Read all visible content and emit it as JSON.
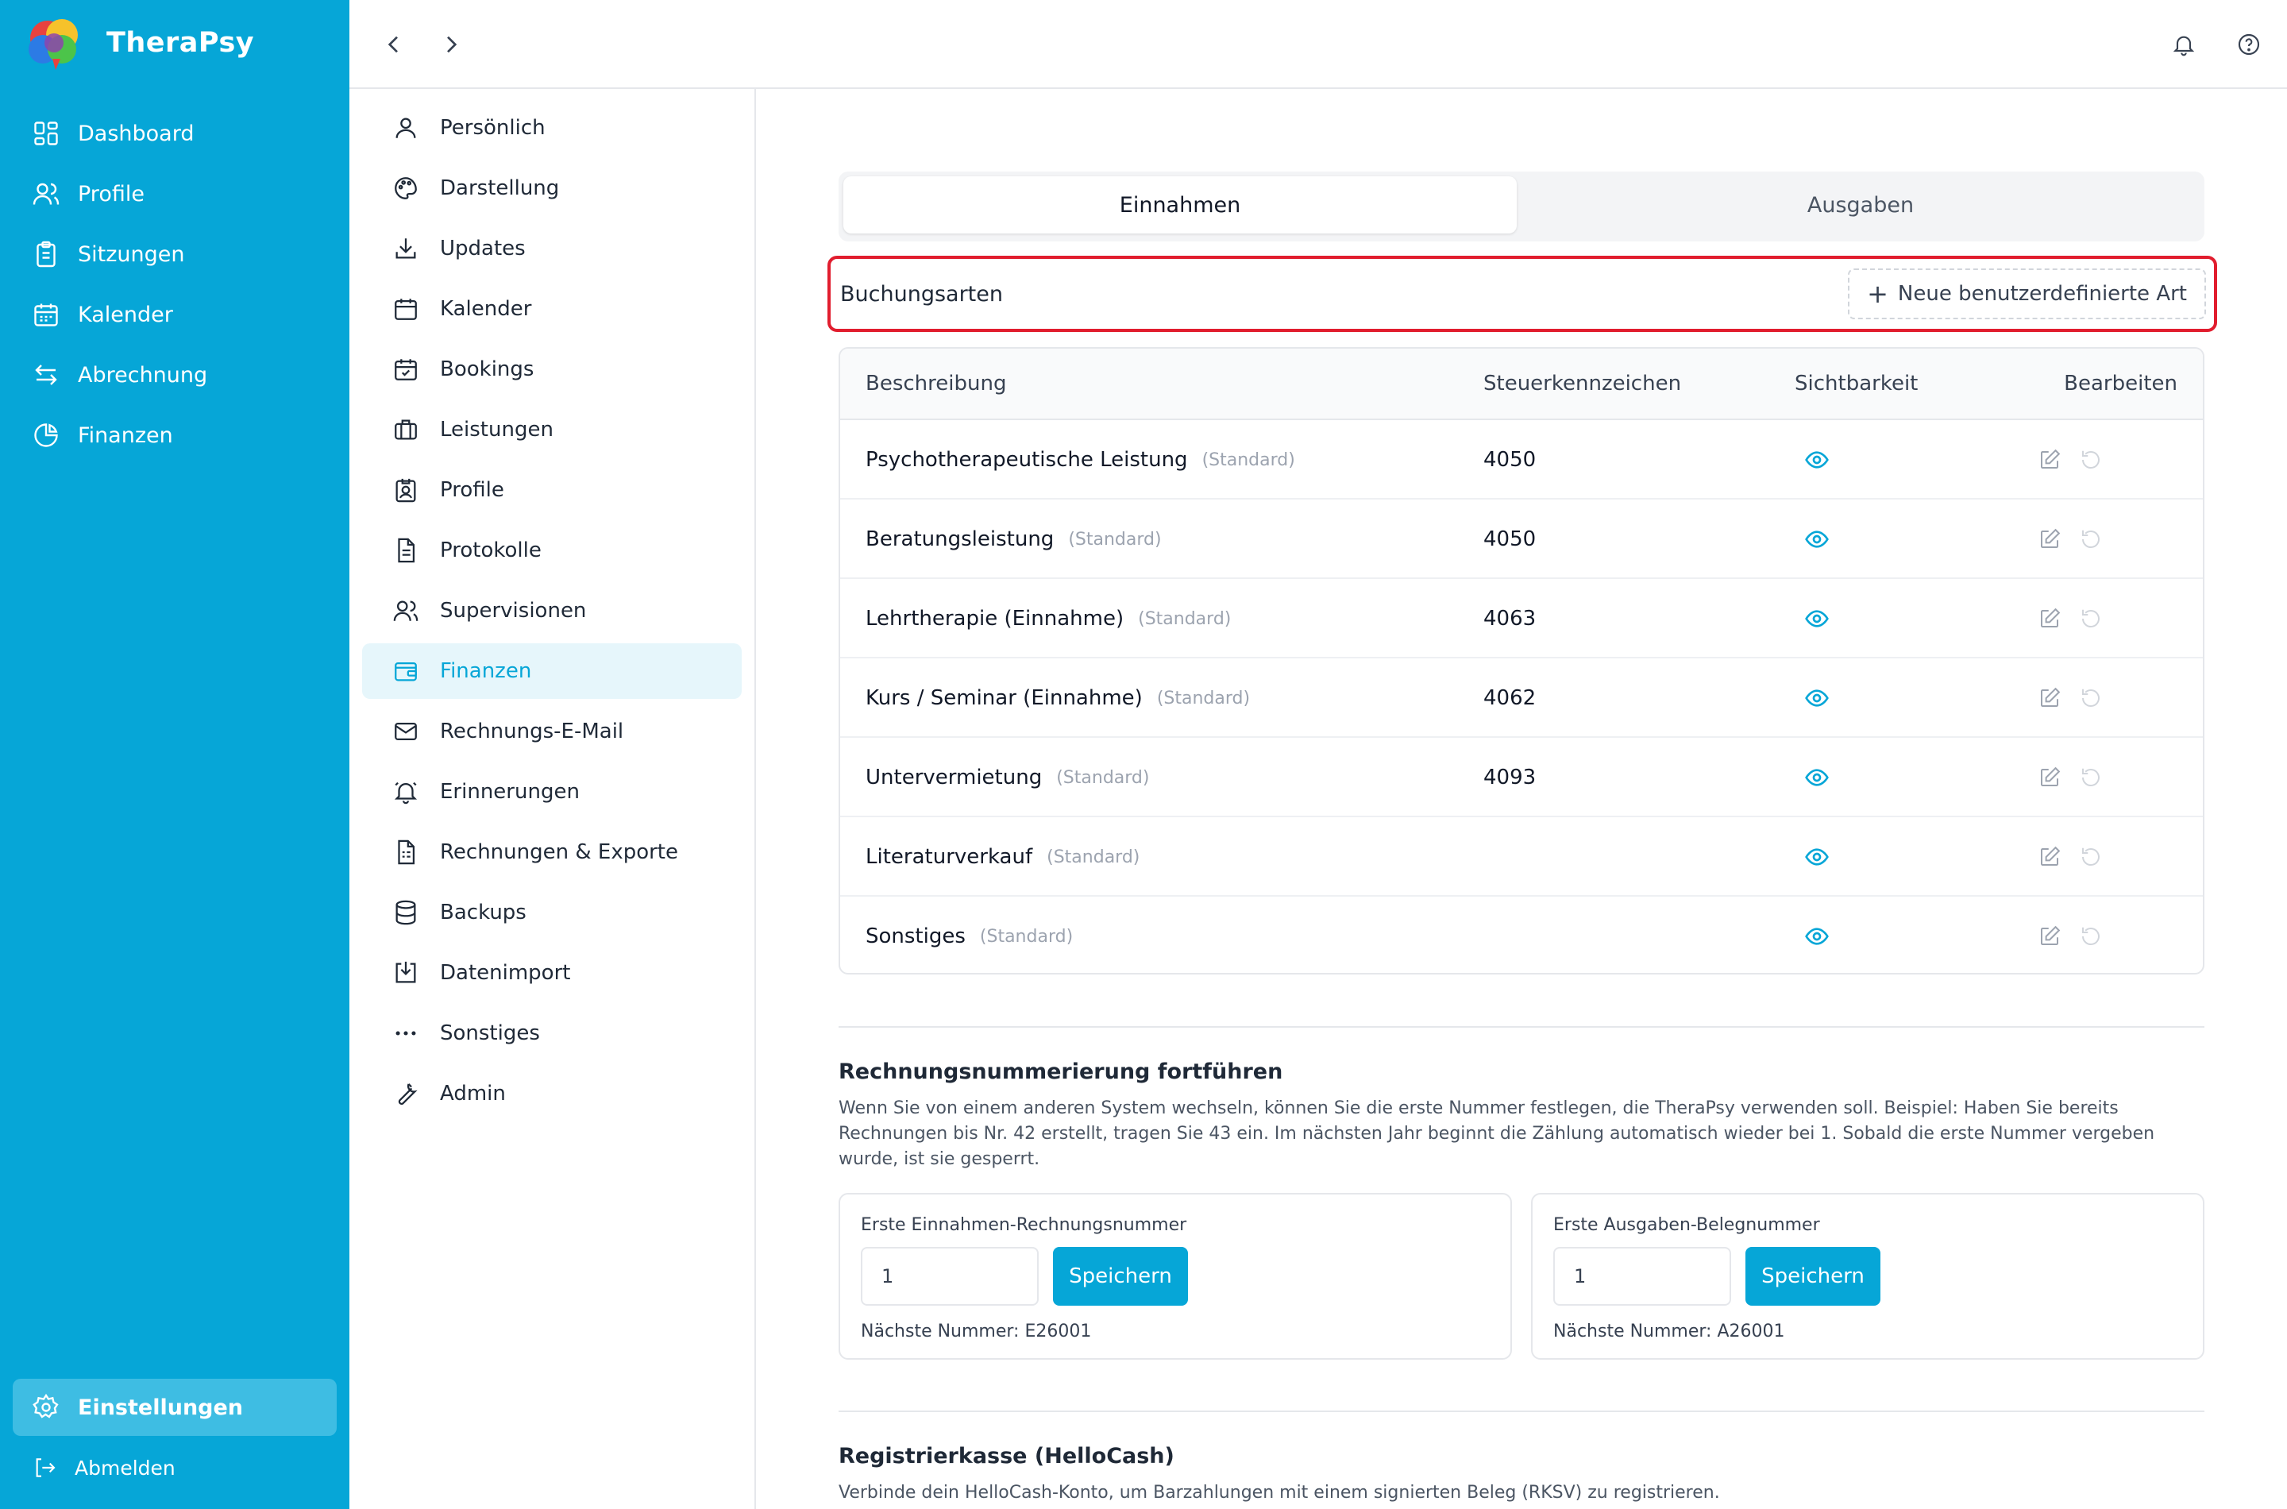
{
  "app": {
    "name": "TheraPsy"
  },
  "colors": {
    "brand": "#06a6d7",
    "highlight": "#e11d2e",
    "sidebar_active": "#3ebde3"
  },
  "sidebar": {
    "items": [
      {
        "label": "Dashboard",
        "icon": "dashboard-icon"
      },
      {
        "label": "Profile",
        "icon": "users-icon"
      },
      {
        "label": "Sitzungen",
        "icon": "clipboard-icon"
      },
      {
        "label": "Kalender",
        "icon": "calendar-icon"
      },
      {
        "label": "Abrechnung",
        "icon": "arrows-icon"
      },
      {
        "label": "Finanzen",
        "icon": "pie-chart-icon"
      }
    ],
    "settings_label": "Einstellungen",
    "logout_label": "Abmelden"
  },
  "submenu": {
    "items": [
      {
        "label": "Persönlich",
        "icon": "user-icon"
      },
      {
        "label": "Darstellung",
        "icon": "palette-icon"
      },
      {
        "label": "Updates",
        "icon": "download-icon"
      },
      {
        "label": "Kalender",
        "icon": "calendar-icon"
      },
      {
        "label": "Bookings",
        "icon": "calendar-check-icon"
      },
      {
        "label": "Leistungen",
        "icon": "briefcase-icon"
      },
      {
        "label": "Profile",
        "icon": "id-badge-icon"
      },
      {
        "label": "Protokolle",
        "icon": "document-icon"
      },
      {
        "label": "Supervisionen",
        "icon": "users-icon"
      },
      {
        "label": "Finanzen",
        "icon": "wallet-icon",
        "active": true
      },
      {
        "label": "Rechnungs-E-Mail",
        "icon": "mail-icon"
      },
      {
        "label": "Erinnerungen",
        "icon": "bell-icon"
      },
      {
        "label": "Rechnungen & Exporte",
        "icon": "invoice-icon"
      },
      {
        "label": "Backups",
        "icon": "database-icon"
      },
      {
        "label": "Datenimport",
        "icon": "import-icon"
      },
      {
        "label": "Sonstiges",
        "icon": "dots-icon"
      },
      {
        "label": "Admin",
        "icon": "wrench-icon"
      }
    ]
  },
  "tabs": {
    "income": "Einnahmen",
    "expenses": "Ausgaben"
  },
  "booking_types": {
    "title": "Buchungsarten",
    "new_button": "Neue benutzerdefinierte Art",
    "columns": {
      "description": "Beschreibung",
      "tax": "Steuerkennzeichen",
      "visibility": "Sichtbarkeit",
      "edit": "Bearbeiten"
    },
    "rows": [
      {
        "name": "Psychotherapeutische Leistung",
        "tag": "(Standard)",
        "tax": "4050"
      },
      {
        "name": "Beratungsleistung",
        "tag": "(Standard)",
        "tax": "4050"
      },
      {
        "name": "Lehrtherapie (Einnahme)",
        "tag": "(Standard)",
        "tax": "4063"
      },
      {
        "name": "Kurs / Seminar (Einnahme)",
        "tag": "(Standard)",
        "tax": "4062"
      },
      {
        "name": "Untervermietung",
        "tag": "(Standard)",
        "tax": "4093"
      },
      {
        "name": "Literaturverkauf",
        "tag": "(Standard)",
        "tax": ""
      },
      {
        "name": "Sonstiges",
        "tag": "(Standard)",
        "tax": ""
      }
    ]
  },
  "numbering": {
    "title": "Rechnungsnummerierung fortführen",
    "description": "Wenn Sie von einem anderen System wechseln, können Sie die erste Nummer festlegen, die TheraPsy verwenden soll. Beispiel: Haben Sie bereits Rechnungen bis Nr. 42 erstellt, tragen Sie 43 ein. Im nächsten Jahr beginnt die Zählung automatisch wieder bei 1. Sobald die erste Nummer vergeben wurde, ist sie gesperrt.",
    "income": {
      "label": "Erste Einnahmen-Rechnungsnummer",
      "value": "1",
      "button": "Speichern",
      "next": "Nächste Nummer: E26001"
    },
    "expenses": {
      "label": "Erste Ausgaben-Belegnummer",
      "value": "1",
      "button": "Speichern",
      "next": "Nächste Nummer: A26001"
    }
  },
  "register": {
    "title": "Registrierkasse (HelloCash)",
    "description": "Verbinde dein HelloCash-Konto, um Barzahlungen mit einem signierten Beleg (RKSV) zu registrieren."
  }
}
